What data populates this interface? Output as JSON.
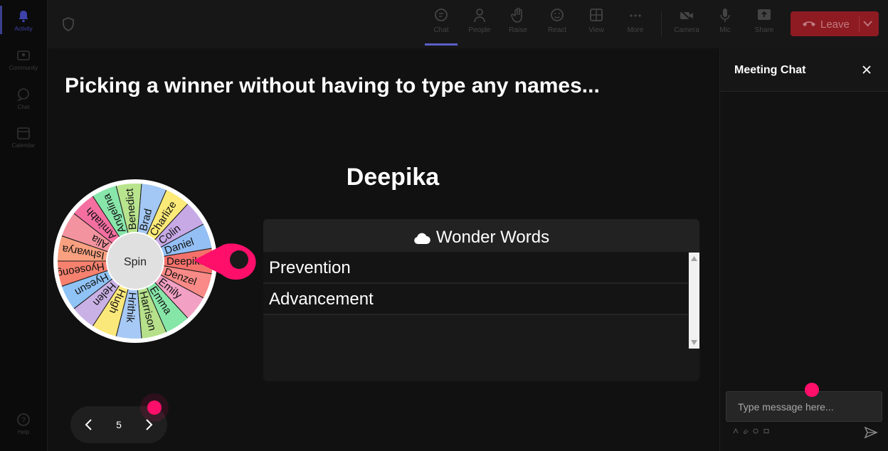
{
  "rail": {
    "items": [
      {
        "label": "Activity",
        "icon": "bell-icon"
      },
      {
        "label": "Community",
        "icon": "community-icon"
      },
      {
        "label": "Chat",
        "icon": "chat-icon"
      },
      {
        "label": "Calendar",
        "icon": "calendar-icon"
      }
    ],
    "help": {
      "label": "Help",
      "icon": "help-icon"
    }
  },
  "topbar": {
    "shield_icon": "shield-icon",
    "buttons": [
      {
        "label": "Chat",
        "icon": "chat-icon"
      },
      {
        "label": "People",
        "icon": "people-icon"
      },
      {
        "label": "Raise",
        "icon": "hand-icon"
      },
      {
        "label": "React",
        "icon": "smile-icon"
      },
      {
        "label": "View",
        "icon": "grid-icon"
      },
      {
        "label": "More",
        "icon": "more-icon"
      },
      {
        "label": "Camera",
        "icon": "camera-off-icon"
      },
      {
        "label": "Mic",
        "icon": "mic-icon"
      },
      {
        "label": "Share",
        "icon": "share-icon"
      }
    ],
    "leave_label": "Leave"
  },
  "main": {
    "title": "Picking a winner without having to type any names...",
    "winner": "Deepika",
    "wheel": {
      "center_label": "Spin",
      "segments": [
        "Deepika",
        "Denzel",
        "Emily",
        "Emma",
        "Harrison",
        "Hrithik",
        "Hugh",
        "Helen",
        "Hyesun",
        "Hyoseong",
        "Ishwarya",
        "Alia",
        "Amitabh",
        "Angelina",
        "Benedict",
        "Brad",
        "Charlize",
        "Colin",
        "Daniel"
      ],
      "colors": [
        "#f4716b",
        "#f98a87",
        "#f2a0c4",
        "#86e6a8",
        "#b6e08a",
        "#a6c9f5",
        "#fbe87a",
        "#c9b1e5",
        "#8fc3f6",
        "#f6816e",
        "#f8a07f",
        "#f3939f",
        "#f46fa0",
        "#88e6aa",
        "#b9e48e",
        "#a4c8f5",
        "#fbea77",
        "#c7a9e6",
        "#93bff5"
      ]
    },
    "wonder_words": {
      "title": "Wonder Words",
      "icon": "cloud-icon",
      "items": [
        "Prevention",
        "Advancement"
      ]
    },
    "nav": {
      "page": "5"
    }
  },
  "chat": {
    "title": "Meeting Chat",
    "input_placeholder": "Type message here..."
  }
}
